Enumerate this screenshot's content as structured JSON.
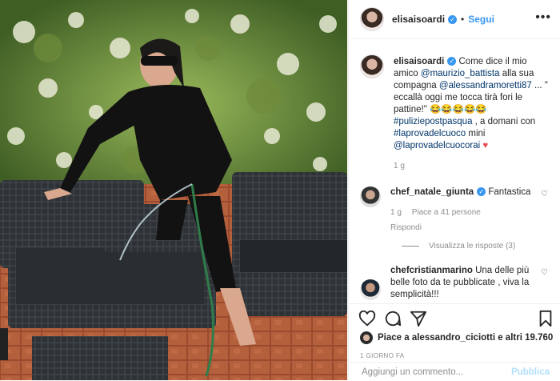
{
  "post": {
    "username": "elisaisoardi",
    "follow_label": "Segui",
    "separator": "•",
    "menu_label": "•••"
  },
  "caption": {
    "username": "elisaisoardi",
    "t1": "Come dice il mio amico",
    "mention1": "@maurizio_battista",
    "t2": "alla sua compagna",
    "mention2": "@alessandramoretti87",
    "t3": "... \" eccallà oggi me tocca tirà fori le pattine!\" 😂😂😂😂😂",
    "hashtag1": "#puliziepostpasqua",
    "t4": ", a domani con",
    "hashtag2": "#laprovadelcuoco",
    "t5": "mini",
    "mention3": "@laprovadelcuocorai",
    "emoji": "♥",
    "time": "1 g"
  },
  "comments": [
    {
      "username": "chef_natale_giunta",
      "text": "Fantastica",
      "time": "1 g",
      "likes": "Piace a 41 persone",
      "reply": "Rispondi",
      "view_replies": "Visualizza le risposte (3)"
    },
    {
      "username": "chefcristianmarino",
      "text": "Una delle più belle foto da te pubblicate , viva la semplicità!!!"
    }
  ],
  "actions": {
    "like_icon": "heart-icon",
    "comment_icon": "comment-icon",
    "share_icon": "share-icon",
    "save_icon": "bookmark-icon"
  },
  "likes_text": "Piace a alessandro_ciciotti e altri 19.760",
  "time_ago": "1 GIORNO FA",
  "compose": {
    "placeholder": "Aggiungi un commento...",
    "publish_label": "Pubblica"
  },
  "colors": {
    "accent": "#3897f0",
    "link": "#003569",
    "heart": "#ed4956"
  }
}
